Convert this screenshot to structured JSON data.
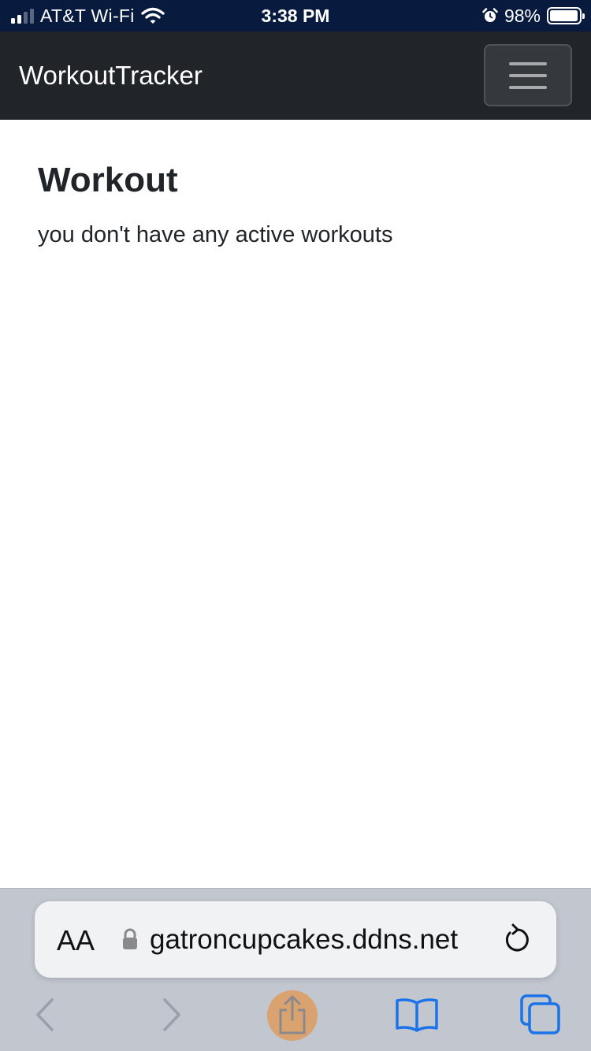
{
  "status_bar": {
    "carrier": "AT&T Wi-Fi",
    "time": "3:38 PM",
    "battery_percent": "98%",
    "battery_level": 0.98,
    "icons": [
      "signal-icon",
      "wifi-icon",
      "alarm-icon",
      "battery-icon"
    ]
  },
  "navbar": {
    "brand": "WorkoutTracker",
    "menu_icon": "hamburger-icon"
  },
  "main": {
    "title": "Workout",
    "empty_message": "you don't have any active workouts"
  },
  "browser": {
    "text_size_label": "AA",
    "url": "gatroncupcakes.ddns.net",
    "icons": [
      "lock-icon",
      "reload-icon",
      "back-icon",
      "forward-icon",
      "share-icon",
      "bookmarks-icon",
      "tabs-icon"
    ]
  },
  "colors": {
    "status_bar_bg": "#081b3f",
    "navbar_bg": "#212529",
    "safari_bar_bg": "#c2c6cf",
    "accent_blue": "#1a73e8",
    "share_highlight": "#d9a26f"
  }
}
